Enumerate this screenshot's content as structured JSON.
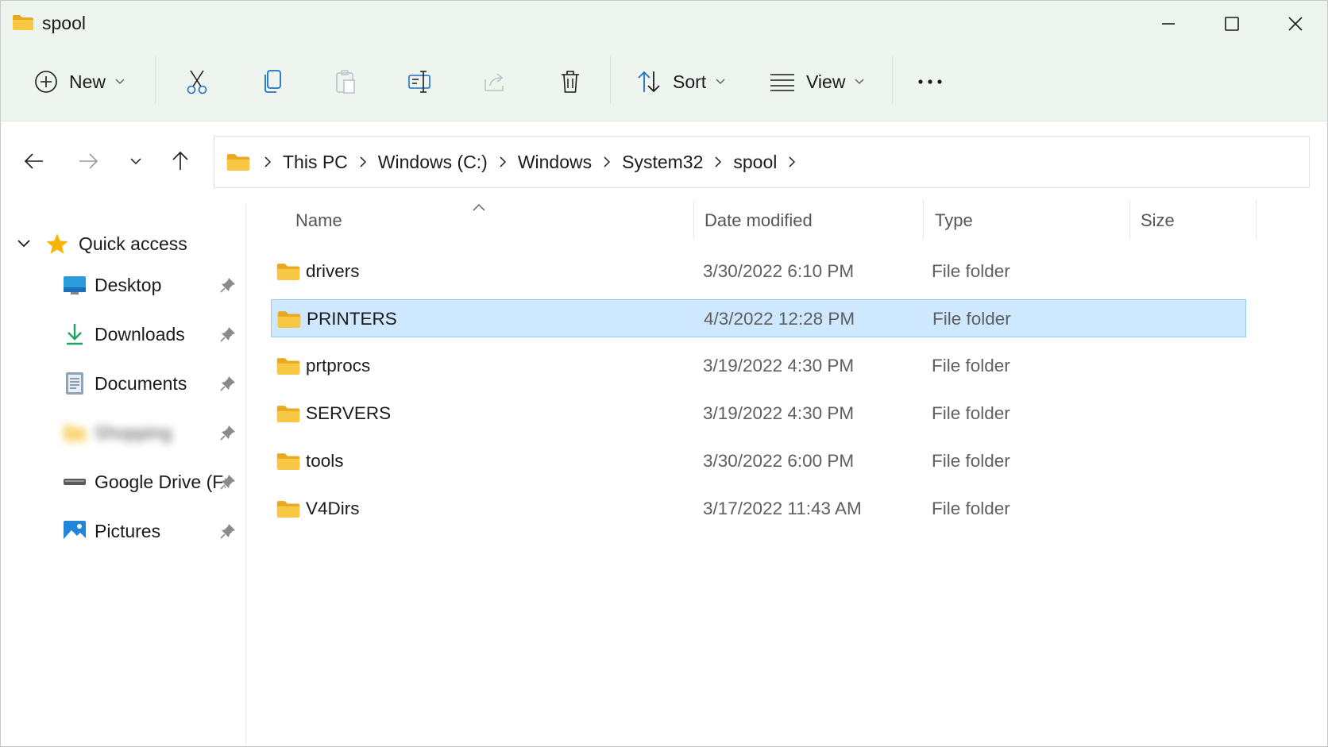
{
  "window": {
    "title": "spool",
    "controls": [
      "minimize",
      "maximize",
      "close"
    ]
  },
  "toolbar": {
    "new_label": "New",
    "sort_label": "Sort",
    "view_label": "View",
    "buttons": [
      "cut-icon",
      "copy-icon",
      "paste-icon",
      "rename-icon",
      "share-icon",
      "delete-icon",
      "more-icon"
    ]
  },
  "address": {
    "breadcrumbs": [
      "This PC",
      "Windows (C:)",
      "Windows",
      "System32",
      "spool"
    ]
  },
  "nav_pane": {
    "quick_access_label": "Quick access",
    "items": [
      {
        "label": "Desktop",
        "icon": "desktop-icon",
        "pinned": true
      },
      {
        "label": "Downloads",
        "icon": "download-icon",
        "pinned": true
      },
      {
        "label": "Documents",
        "icon": "documents-icon",
        "pinned": true
      },
      {
        "label": "Shopping",
        "icon": "folder-icon",
        "pinned": true,
        "blurred": true
      },
      {
        "label": "Google Drive (F:",
        "icon": "drive-icon",
        "pinned": true
      },
      {
        "label": "Pictures",
        "icon": "pictures-icon",
        "pinned": true
      }
    ]
  },
  "columns": {
    "name": "Name",
    "date": "Date modified",
    "type": "Type",
    "size": "Size"
  },
  "files": [
    {
      "name": "drivers",
      "date": "3/30/2022 6:10 PM",
      "type": "File folder",
      "selected": false
    },
    {
      "name": "PRINTERS",
      "date": "4/3/2022 12:28 PM",
      "type": "File folder",
      "selected": true
    },
    {
      "name": "prtprocs",
      "date": "3/19/2022 4:30 PM",
      "type": "File folder",
      "selected": false
    },
    {
      "name": "SERVERS",
      "date": "3/19/2022 4:30 PM",
      "type": "File folder",
      "selected": false
    },
    {
      "name": "tools",
      "date": "3/30/2022 6:00 PM",
      "type": "File folder",
      "selected": false
    },
    {
      "name": "V4Dirs",
      "date": "3/17/2022 11:43 AM",
      "type": "File folder",
      "selected": false
    }
  ],
  "colors": {
    "accent": "#0067c0",
    "selection_bg": "#cde8ff",
    "selection_border": "#99c9f3",
    "folder": "#f8c845",
    "titlebar_bg": "#eef5ef"
  }
}
